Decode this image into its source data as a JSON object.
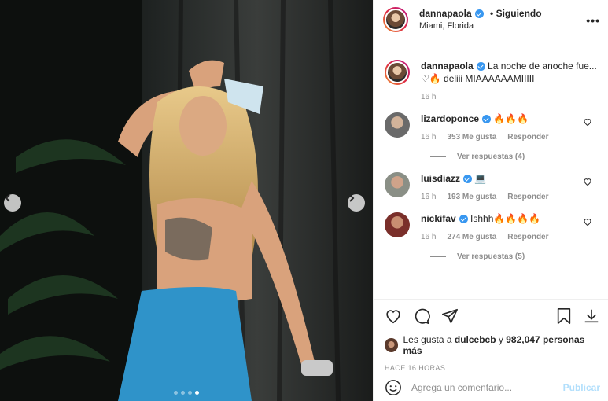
{
  "post": {
    "username": "dannapaola",
    "follow_status": "Siguiendo",
    "follow_prefix": "•",
    "location": "Miami, Florida",
    "more_label": "•••",
    "caption_text": "La noche de anoche fue... ♡🔥 deliii MIAAAAAAMIIIII",
    "caption_time": "16 h",
    "carousel": {
      "slides": 4,
      "active": 4
    }
  },
  "comments": [
    {
      "username": "lizardoponce",
      "text": "🔥🔥🔥",
      "time": "16 h",
      "likes": "353 Me gusta",
      "reply": "Responder",
      "replies": "Ver respuestas (4)"
    },
    {
      "username": "luisdiazz",
      "text": "💻",
      "time": "16 h",
      "likes": "193 Me gusta",
      "reply": "Responder"
    },
    {
      "username": "nickifav",
      "text": "Ishhh🔥🔥🔥🔥",
      "time": "16 h",
      "likes": "274 Me gusta",
      "reply": "Responder",
      "replies": "Ver respuestas (5)"
    }
  ],
  "likes": {
    "prefix": "Les gusta a",
    "user": "dulcebcb",
    "middle": "y",
    "count": "982,047 personas más"
  },
  "posted_ago": "HACE 16 HORAS",
  "add_comment": {
    "placeholder": "Agrega un comentario...",
    "publish": "Publicar"
  },
  "colors": {
    "verified": "#3897f0",
    "publish": "#b2dffc",
    "muted": "#8e8e8e"
  }
}
